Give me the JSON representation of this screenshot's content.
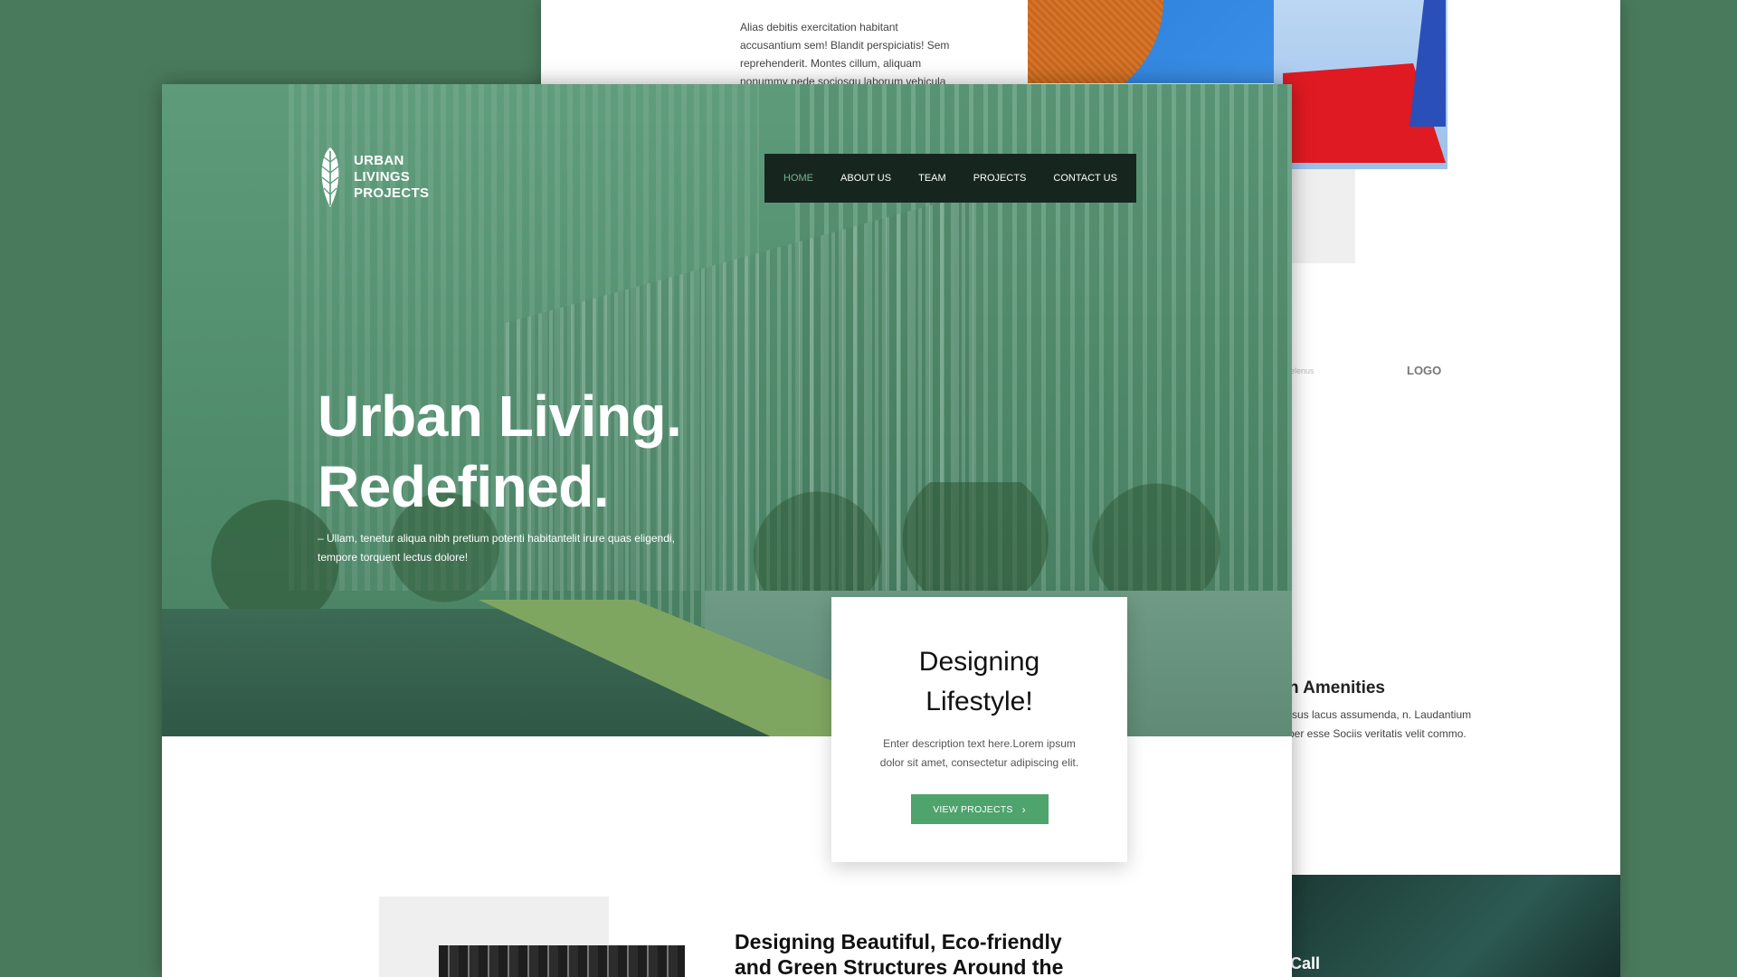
{
  "back_page": {
    "intro_text": "Alias debitis exercitation habitant accusantium sem! Blandit perspiciatis! Sem reprehenderit. Montes cillum, aliquam nonummy pede sociosqu laborum vehicula",
    "tiny_text": "elenus",
    "logo_text": "LOGO",
    "amenities_title": "n Amenities",
    "amenities_text": "rsus lacus assumenda, n. Laudantium per esse Sociis veritatis velit commo.",
    "call_label": "Call"
  },
  "brand": {
    "line1": "URBAN",
    "line2": "LIVINGS",
    "line3": "PROJECTS"
  },
  "nav": {
    "items": [
      {
        "label": "HOME",
        "active": true
      },
      {
        "label": "ABOUT US",
        "active": false
      },
      {
        "label": "TEAM",
        "active": false
      },
      {
        "label": "PROJECTS",
        "active": false
      },
      {
        "label": "CONTACT US",
        "active": false
      }
    ]
  },
  "hero": {
    "headline_line1": "Urban Living.",
    "headline_line2": "Redefined.",
    "subline": "– Ullam, tenetur aliqua nibh pretium potenti habitantelit irure quas eligendi, tempore torquent lectus dolore!"
  },
  "card": {
    "title_line1": "Designing",
    "title_line2": "Lifestyle!",
    "description": "Enter description text here.Lorem ipsum dolor sit amet, consectetur adipiscing elit.",
    "button_label": "VIEW PROJECTS",
    "button_icon": "chevron-right-icon"
  },
  "section": {
    "title_line1": "Designing Beautiful, Eco-friendly",
    "title_line2": "and Green Structures Around the"
  },
  "colors": {
    "background": "#4a7a5c",
    "accent_green": "#4fa36d",
    "nav_bg": "#17251f",
    "nav_active": "#74b68e"
  }
}
